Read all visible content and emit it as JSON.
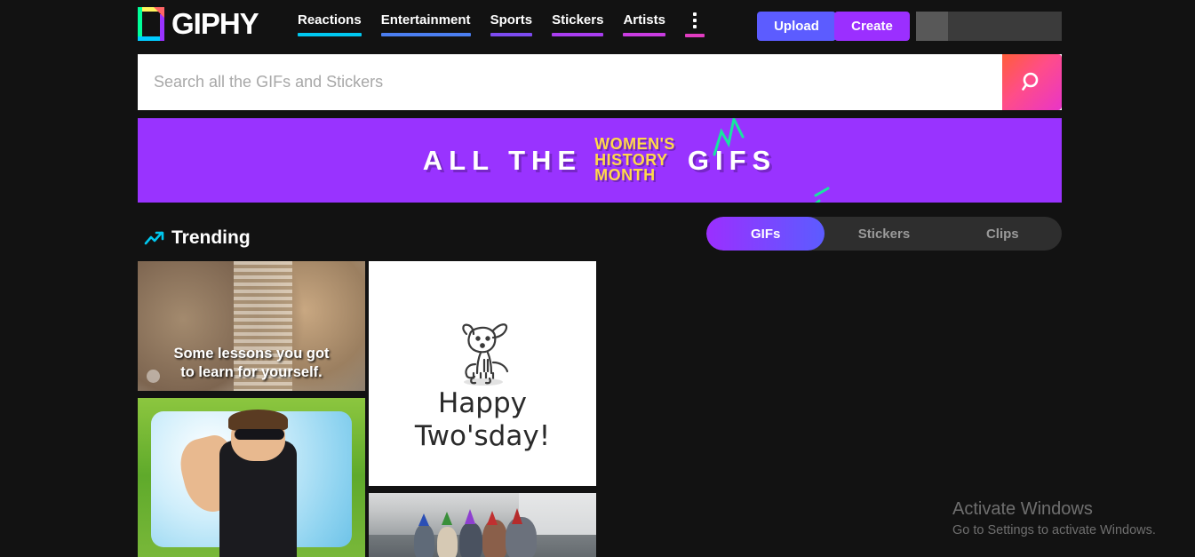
{
  "header": {
    "logo_text": "GIPHY",
    "nav": [
      {
        "label": "Reactions",
        "bar_color": "#00c8f0"
      },
      {
        "label": "Entertainment",
        "bar_color": "#4b7ef0"
      },
      {
        "label": "Sports",
        "bar_color": "#7d4bf0"
      },
      {
        "label": "Stickers",
        "bar_color": "#a93df0"
      },
      {
        "label": "Artists",
        "bar_color": "#c93ce0"
      }
    ],
    "more_menu_bar_color": "#e03cc0",
    "upload_label": "Upload",
    "create_label": "Create",
    "upload_color": "#5c5cff",
    "create_color": "#9b2fff"
  },
  "search": {
    "value": "",
    "placeholder": "Search all the GIFs and Stickers"
  },
  "banner": {
    "text_before": "ALL THE",
    "highlight_line1": "WOMEN'S",
    "highlight_line2": "HISTORY",
    "highlight_line3": "MONTH",
    "text_after": "GIFS",
    "background": "#9933ff",
    "highlight_color": "#ffd94a",
    "spark_color": "#18e5a0"
  },
  "content": {
    "trending_label": "Trending",
    "tabs": [
      {
        "label": "GIFs",
        "active": true
      },
      {
        "label": "Stickers",
        "active": false
      },
      {
        "label": "Clips",
        "active": false
      }
    ],
    "gifs": [
      {
        "name": "two-women-talking",
        "caption_line1": "Some lessons you got",
        "caption_line2": "to learn for yourself."
      },
      {
        "name": "man-sunglasses-clapping",
        "caption_line1": "",
        "caption_line2": ""
      },
      {
        "name": "happy-twosday-dog",
        "caption_line1": "Happy",
        "caption_line2": "Two'sday!"
      },
      {
        "name": "office-party-hats",
        "caption_line1": "",
        "caption_line2": ""
      }
    ]
  },
  "watermark": {
    "title": "Activate Windows",
    "subtitle": "Go to Settings to activate Windows."
  }
}
